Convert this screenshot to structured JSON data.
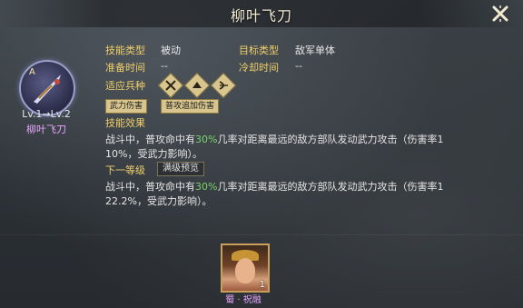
{
  "title": "柳叶飞刀",
  "skill": {
    "grade": "A",
    "level_text": "Lv.1→Lv.2",
    "name": "柳叶飞刀"
  },
  "info": {
    "type_label": "技能类型",
    "type_value": "被动",
    "target_label": "目标类型",
    "target_value": "敌军单体",
    "prep_label": "准备时间",
    "prep_value": "--",
    "cooldown_label": "冷却时间",
    "cooldown_value": "--",
    "troops_label": "适应兵种",
    "troops": [
      "cavalry-icon",
      "shield-icon",
      "archer-icon"
    ]
  },
  "tags": [
    "武力伤害",
    "普攻追加伤害"
  ],
  "effect": {
    "label": "技能效果",
    "text_before": "战斗中，普攻命中有",
    "percent": "30%",
    "text_after_line1": "几率对距离最远的敌方部队发动武力攻击（伤害率1",
    "text_line2": "10%，受武力影响）。"
  },
  "next_level": {
    "label": "下一等级",
    "button": "满级预览",
    "text_before": "战斗中，普攻命中有",
    "percent": "30%",
    "text_after_line1": "几率对距离最远的敌方部队发动武力攻击（伤害率1",
    "text_line2": "22.2%，受武力影响）。"
  },
  "hero": {
    "count": "1",
    "name": "蜀 · 祝融"
  },
  "colors": {
    "label": "#f1cf6a",
    "percent": "#79d46b",
    "name": "#e8a6ff"
  }
}
